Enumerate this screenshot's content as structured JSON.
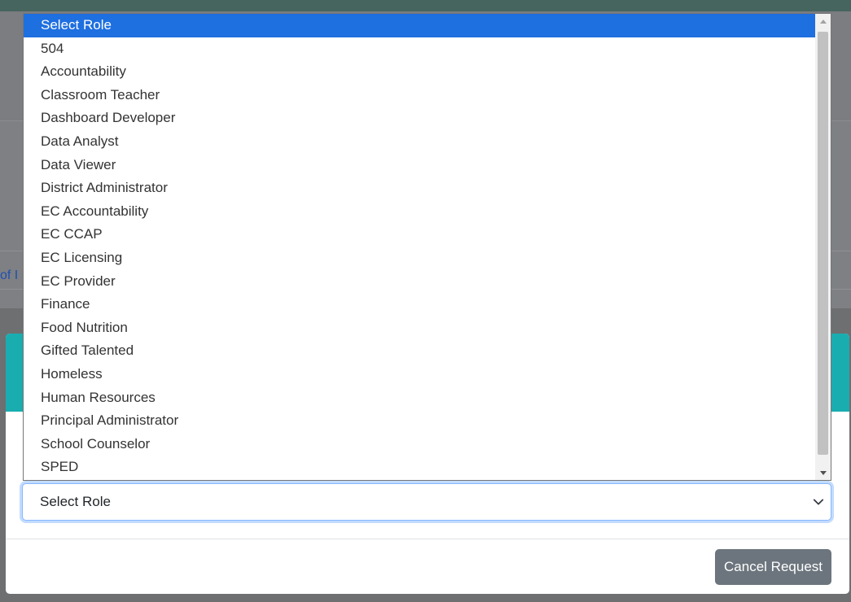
{
  "backdrop": {
    "link_fragment": "of I"
  },
  "role_select": {
    "current_value": "Select Role",
    "options": [
      "Select Role",
      "504",
      "Accountability",
      "Classroom Teacher",
      "Dashboard Developer",
      "Data Analyst",
      "Data Viewer",
      "District Administrator",
      "EC Accountability",
      "EC CCAP",
      "EC Licensing",
      "EC Provider",
      "Finance",
      "Food Nutrition",
      "Gifted Talented",
      "Homeless",
      "Human Resources",
      "Principal Administrator",
      "School Counselor",
      "SPED"
    ],
    "highlighted_option": "Select Role"
  },
  "modal": {
    "cancel_label": "Cancel Request"
  },
  "colors": {
    "highlight": "#1e6fe0",
    "modal_header": "#19adb0",
    "cancel_button": "#6c757d",
    "top_bar": "#46655e"
  },
  "icons": {
    "select_arrow": "chevron-down-icon",
    "scroll_up": "triangle-up-icon",
    "scroll_down": "triangle-down-icon"
  }
}
